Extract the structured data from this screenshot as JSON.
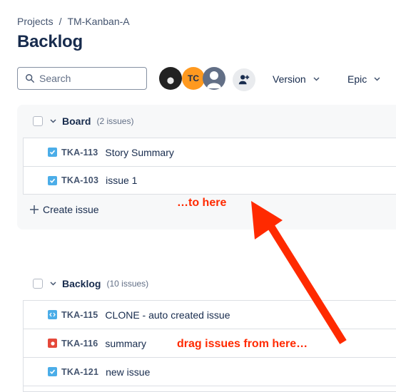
{
  "breadcrumb": {
    "items": [
      "Projects",
      "TM-Kanban-A"
    ],
    "separator": "/"
  },
  "page_title": "Backlog",
  "toolbar": {
    "search": {
      "placeholder": "Search",
      "value": ""
    },
    "avatars": [
      {
        "kind": "photo",
        "label": ""
      },
      {
        "kind": "initials",
        "label": "TC",
        "color": "#ff991f"
      },
      {
        "kind": "default",
        "label": ""
      }
    ],
    "add_people_icon": "person-add-icon",
    "filters": [
      {
        "label": "Version"
      },
      {
        "label": "Epic"
      }
    ]
  },
  "sections": [
    {
      "name": "Board",
      "count_label": "(2 issues)",
      "issues": [
        {
          "type": "task",
          "key": "TKA-113",
          "summary": "Story Summary"
        },
        {
          "type": "task",
          "key": "TKA-103",
          "summary": "issue 1"
        }
      ],
      "create_label": "Create issue"
    },
    {
      "name": "Backlog",
      "count_label": "(10 issues)",
      "issues": [
        {
          "type": "subtask",
          "key": "TKA-115",
          "summary": "CLONE - auto created issue"
        },
        {
          "type": "bug",
          "key": "TKA-116",
          "summary": "summary"
        },
        {
          "type": "task",
          "key": "TKA-121",
          "summary": "new issue"
        }
      ]
    }
  ],
  "annotations": {
    "target": "…to here",
    "source": "drag issues from here…",
    "color": "#ff2a00"
  }
}
